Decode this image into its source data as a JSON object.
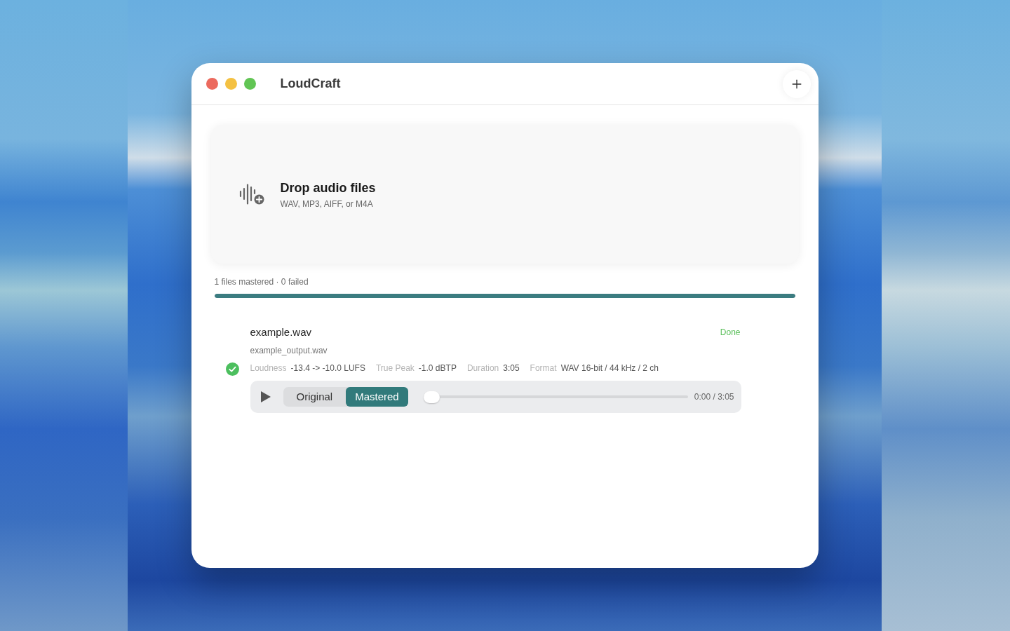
{
  "window": {
    "title": "LoudCraft"
  },
  "drop_zone": {
    "title": "Drop audio files",
    "subtitle": "WAV, MP3, AIFF, or M4A"
  },
  "summary": {
    "text": "1 files mastered · 0 failed",
    "level": 1
  },
  "files": [
    {
      "name": "example.wav",
      "status": "Done",
      "done": true,
      "output": "example_output.wav",
      "stats": [
        {
          "label": "Loudness",
          "value": "-13.4 -> -10.0 LUFS"
        },
        {
          "label": "True Peak",
          "value": "-1.0 dBTP"
        },
        {
          "label": "Duration",
          "value": "3:05"
        },
        {
          "label": "Format",
          "value": "WAV 16-bit / 44 kHz / 2 ch"
        }
      ],
      "player": {
        "modes": [
          {
            "label": "Original",
            "selected": false
          },
          {
            "label": "Mastered",
            "selected": true
          }
        ],
        "level": 0,
        "time": "0:00 / 3:05"
      }
    }
  ]
}
